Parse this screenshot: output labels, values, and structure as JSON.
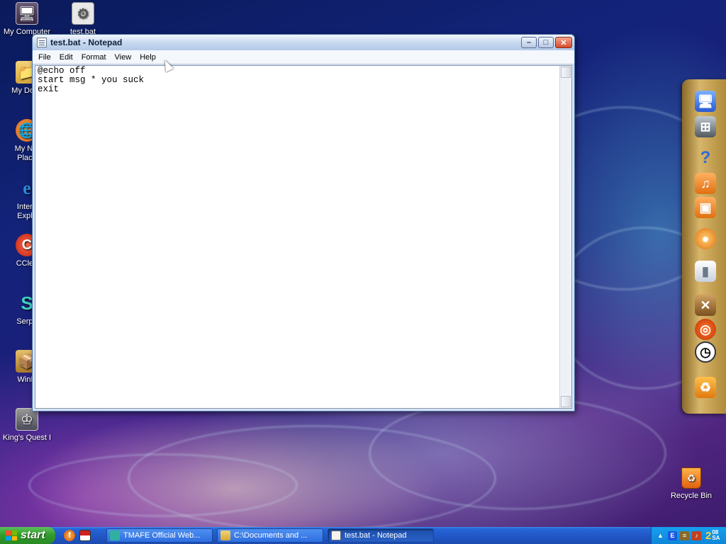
{
  "desktop": {
    "icons": [
      {
        "label": "My Computer",
        "icon": "my-computer-icon"
      },
      {
        "label": "test.bat",
        "icon": "batch-file-icon"
      },
      {
        "label": "My Docu",
        "icon": "my-documents-icon"
      },
      {
        "label": "My Net\nPlace",
        "icon": "network-places-icon"
      },
      {
        "label": "Intern\nExplo",
        "icon": "internet-explorer-icon"
      },
      {
        "label": "CClea",
        "icon": "ccleaner-icon"
      },
      {
        "label": "Serpe",
        "icon": "serpent-icon"
      },
      {
        "label": "WinR",
        "icon": "winrar-icon"
      },
      {
        "label": "King's Quest I",
        "icon": "kings-quest-icon"
      }
    ],
    "recycle_bin": {
      "label": "Recycle Bin",
      "icon": "recycle-bin-icon"
    }
  },
  "notepad": {
    "title": "test.bat - Notepad",
    "menu": [
      "File",
      "Edit",
      "Format",
      "View",
      "Help"
    ],
    "content": "@echo off\nstart msg * you suck\nexit",
    "buttons": {
      "minimize": "–",
      "maximize": "□",
      "close": "✕"
    }
  },
  "dock": {
    "items": [
      "computer-icon",
      "network-icon",
      "help-icon",
      "music-folder-icon",
      "pictures-folder-icon",
      "media-icon",
      "ipod-icon",
      "tools-icon",
      "ubuntu-icon",
      "clock-icon",
      "recycle-icon"
    ],
    "help_glyph": "?"
  },
  "taskbar": {
    "start_label": "start",
    "tasks": [
      {
        "label": "TMAFE Official Web...",
        "icon": "serpent-icon",
        "active": false
      },
      {
        "label": "C:\\Documents and ...",
        "icon": "folder-icon",
        "active": false
      },
      {
        "label": "test.bat - Notepad",
        "icon": "notepad-icon",
        "active": true
      }
    ],
    "tray": {
      "clock_hour": "2",
      "clock_min_top": "08",
      "clock_min_bottom": "SA"
    }
  },
  "colors": {
    "title_bar": "#c8d9f0",
    "taskbar": "#2158c8",
    "start_button": "#2f9a2a",
    "dock": "#d7b56a",
    "tray": "#0f86d8"
  }
}
